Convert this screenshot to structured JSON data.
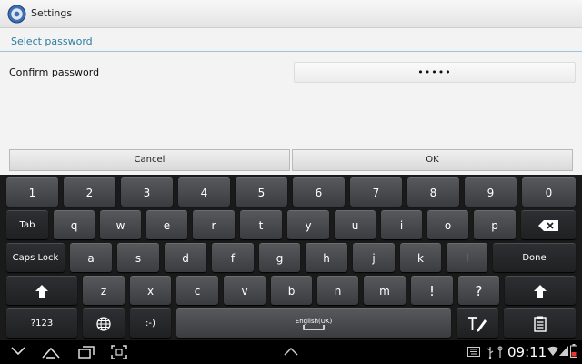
{
  "window": {
    "title": "Settings"
  },
  "section": {
    "title": "Select password"
  },
  "form": {
    "label": "Confirm password",
    "value": "•••••"
  },
  "dialog": {
    "cancel_label": "Cancel",
    "ok_label": "OK"
  },
  "keyboard": {
    "row1": [
      "1",
      "2",
      "3",
      "4",
      "5",
      "6",
      "7",
      "8",
      "9",
      "0"
    ],
    "tab_label": "Tab",
    "row2": [
      "q",
      "w",
      "e",
      "r",
      "t",
      "y",
      "u",
      "i",
      "o",
      "p"
    ],
    "capslock_label": "Caps Lock",
    "row3": [
      "a",
      "s",
      "d",
      "f",
      "g",
      "h",
      "j",
      "k",
      "l"
    ],
    "done_label": "Done",
    "row4": [
      "z",
      "x",
      "c",
      "v",
      "b",
      "n",
      "m",
      "!",
      "?"
    ],
    "sym_label": "?123",
    "emoticon_label": ":-)",
    "space_label": "English(UK)"
  },
  "statusbar": {
    "time": "09:11"
  },
  "colors": {
    "accent": "#2b7fa3",
    "keyboard_bg": "#1a1a1a"
  }
}
